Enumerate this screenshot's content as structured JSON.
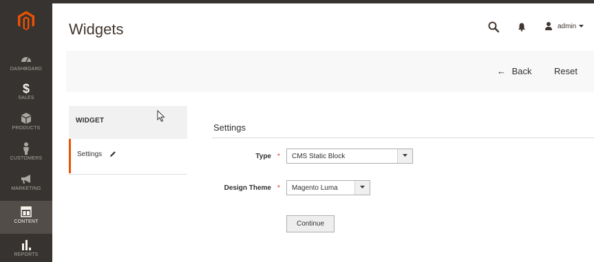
{
  "sidebar": {
    "items": [
      {
        "label": "DASHBOARD",
        "icon": "dashboard-icon"
      },
      {
        "label": "SALES",
        "icon": "dollar-icon"
      },
      {
        "label": "PRODUCTS",
        "icon": "box-icon"
      },
      {
        "label": "CUSTOMERS",
        "icon": "person-icon"
      },
      {
        "label": "MARKETING",
        "icon": "megaphone-icon"
      },
      {
        "label": "CONTENT",
        "icon": "layout-icon"
      },
      {
        "label": "REPORTS",
        "icon": "bar-chart-icon"
      }
    ],
    "active": "CONTENT"
  },
  "header": {
    "title": "Widgets",
    "user": "admin"
  },
  "actions": {
    "back_label": "Back",
    "reset_label": "Reset"
  },
  "tabs": {
    "heading": "WIDGET",
    "items": [
      {
        "label": "Settings"
      }
    ]
  },
  "form": {
    "section_title": "Settings",
    "type_label": "Type",
    "type_value": "CMS Static Block",
    "theme_label": "Design Theme",
    "theme_value": "Magento Luma",
    "required_mark": "*",
    "continue_label": "Continue"
  },
  "colors": {
    "sidebar_bg": "#373330",
    "accent": "#eb5202",
    "required": "#e22626"
  }
}
